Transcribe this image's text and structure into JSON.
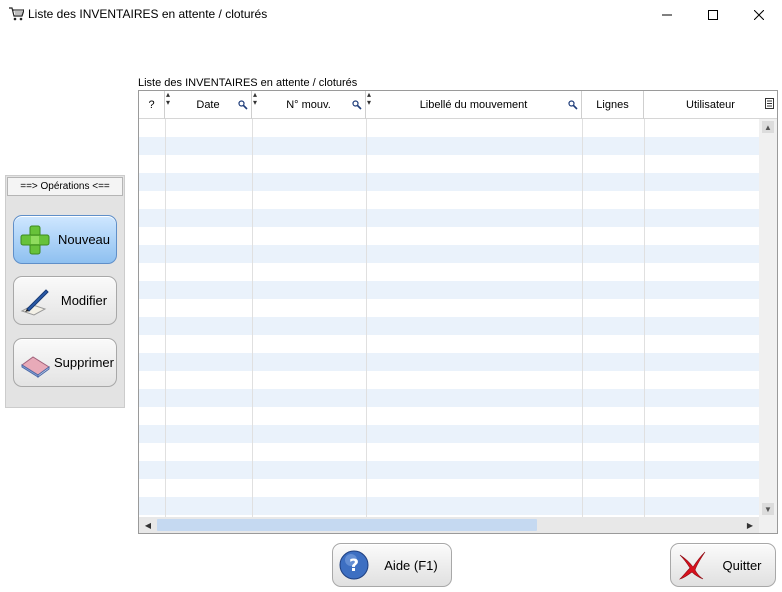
{
  "window": {
    "title": "Liste des INVENTAIRES en attente / cloturés"
  },
  "grid": {
    "caption": "Liste des INVENTAIRES en attente / cloturés",
    "columns": [
      "?",
      "Date",
      "N° mouv.",
      "Libellé du mouvement",
      "Lignes",
      "Utilisateur"
    ]
  },
  "operations": {
    "title": "==> Opérations <==",
    "buttons": [
      "Nouveau",
      "Modifier",
      "Supprimer"
    ]
  },
  "footer": {
    "help_label": "Aide (F1)",
    "quit_label": "Quitter"
  },
  "colors": {
    "row_alt": "#eaf2fb",
    "primary_button": "#8ec0f0",
    "scroll_thumb": "#c5d9f1"
  }
}
